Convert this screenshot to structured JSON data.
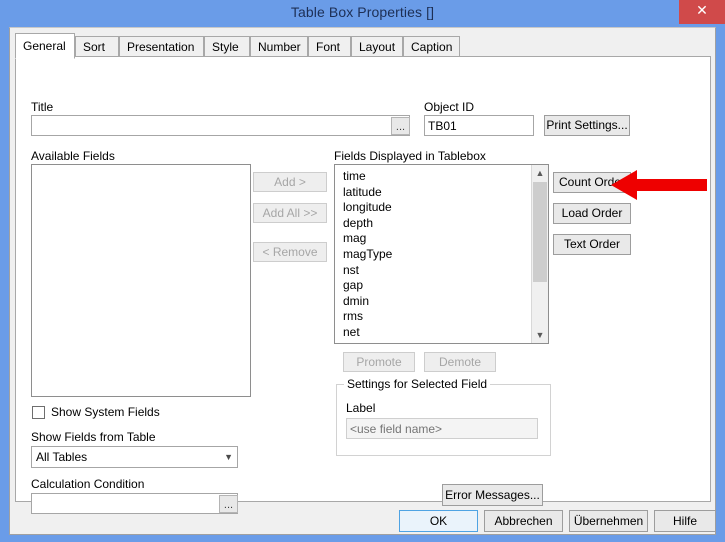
{
  "window": {
    "title": "Table Box Properties []",
    "close_label": "✕",
    "titlebar_color": "#6a9ce8",
    "close_color": "#d04a4a"
  },
  "tabs": [
    {
      "label": "General",
      "active": true
    },
    {
      "label": "Sort",
      "active": false
    },
    {
      "label": "Presentation",
      "active": false
    },
    {
      "label": "Style",
      "active": false
    },
    {
      "label": "Number",
      "active": false
    },
    {
      "label": "Font",
      "active": false
    },
    {
      "label": "Layout",
      "active": false
    },
    {
      "label": "Caption",
      "active": false
    }
  ],
  "general": {
    "title_label": "Title",
    "title_value": "",
    "title_placeholder": "",
    "title_browse_label": "...",
    "object_id_label": "Object ID",
    "object_id_value": "TB01",
    "print_settings_label": "Print Settings...",
    "available_fields_label": "Available Fields",
    "available_fields_items": [],
    "transfer_buttons": [
      {
        "label": "Add >",
        "enabled": false
      },
      {
        "label": "Add All >>",
        "enabled": false
      },
      {
        "label": "< Remove",
        "enabled": false
      }
    ],
    "displayed_fields_label": "Fields Displayed in Tablebox",
    "displayed_fields_items": [
      "time",
      "latitude",
      "longitude",
      "depth",
      "mag",
      "magType",
      "nst",
      "gap",
      "dmin",
      "rms",
      "net"
    ],
    "order_buttons": [
      {
        "label": "Count Order",
        "enabled": true
      },
      {
        "label": "Load Order",
        "enabled": true
      },
      {
        "label": "Text Order",
        "enabled": true
      }
    ],
    "promote_label": "Promote",
    "demote_label": "Demote",
    "settings_group_label": "Settings for Selected Field",
    "field_label_caption": "Label",
    "field_label_value": "",
    "field_label_placeholder": "<use field name>",
    "show_system_fields_label": "Show System Fields",
    "show_system_fields_checked": false,
    "show_fields_from_table_label": "Show Fields from Table",
    "show_fields_from_table_value": "All Tables",
    "show_fields_from_table_options": [
      "All Tables"
    ],
    "calculation_condition_label": "Calculation Condition",
    "calculation_condition_value": "",
    "calculation_condition_browse_label": "...",
    "error_messages_label": "Error Messages..."
  },
  "footer": {
    "ok_label": "OK",
    "cancel_label": "Abbrechen",
    "apply_label": "Übernehmen",
    "help_label": "Hilfe"
  },
  "annotation": {
    "arrow_color": "#ee0000",
    "points_at": "Load Order"
  }
}
